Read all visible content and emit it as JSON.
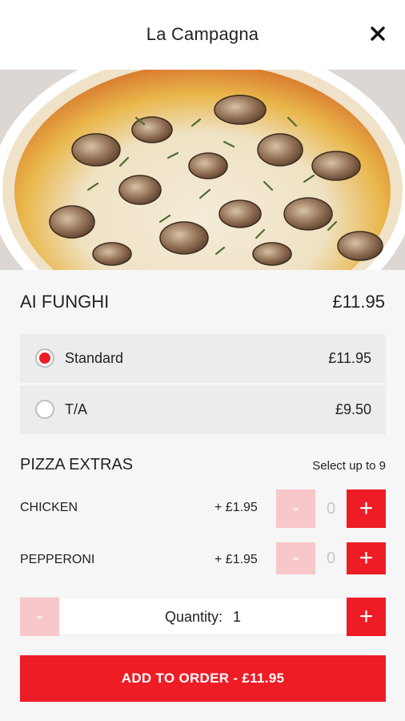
{
  "header": {
    "title": "La Campagna",
    "close_icon": "close-icon"
  },
  "hero": {
    "icon": "pizza-photo"
  },
  "item": {
    "name": "AI FUNGHI",
    "price": "£11.95"
  },
  "options": [
    {
      "label": "Standard",
      "price": "£11.95",
      "selected": true
    },
    {
      "label": "T/A",
      "price": "£9.50",
      "selected": false
    }
  ],
  "extras": {
    "title": "PIZZA EXTRAS",
    "limit": "Select up to 9",
    "items": [
      {
        "name": "CHICKEN",
        "price": "+ £1.95",
        "count": "0",
        "minus": "-",
        "plus": "+"
      },
      {
        "name": "PEPPERONI",
        "price": "+ £1.95",
        "count": "0",
        "minus": "-",
        "plus": "+"
      }
    ]
  },
  "quantity": {
    "label": "Quantity:",
    "value": "1",
    "minus": "-",
    "plus": "+"
  },
  "add_button": {
    "label": "ADD TO ORDER  -  £11.95"
  },
  "colors": {
    "accent": "#ee1c25",
    "accent_disabled": "#f8c7c9",
    "option_bg": "#ececec",
    "page_bg": "#f6f6f6"
  }
}
